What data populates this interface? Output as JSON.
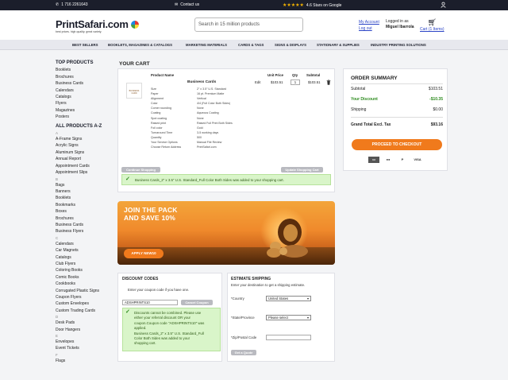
{
  "topbar": {
    "phone": "1 716 2261643",
    "contact": "Contact us",
    "rating_stars": "★★★★★",
    "rating_text": "4.6 Stars on Google"
  },
  "header": {
    "logo_text": "PrintSafari.com",
    "logo_tagline": "best prices. high quality. great variety.",
    "search_placeholder": "Search in 15 million products",
    "my_account": "My Account",
    "logout": "Log out",
    "logged_in_as": "Logged in as",
    "user_name": "Miguel Ibarrola",
    "cart_label": "Cart (1 Items)"
  },
  "nav": {
    "items": [
      "BEST SELLERS",
      "BOOKLETS, MAGAZINES & CATALOGS",
      "MARKETING MATERIALS",
      "CARDS & TAGS",
      "SIGNS & DISPLAYS",
      "STATIONARY & SUPPLIES",
      "INDUSTRY PRINTING SOLUTIONS"
    ]
  },
  "sidebar": {
    "top_products_title": "TOP PRODUCTS",
    "top_products": [
      "Booklets",
      "Brochures",
      "Business Cards",
      "Calendars",
      "Catalogs",
      "Flyers",
      "Magazines",
      "Posters"
    ],
    "all_title": "ALL PRODUCTS A-Z",
    "groups": [
      {
        "letter": "A",
        "items": [
          "A-Frame Signs",
          "Acrylic Signs",
          "Aluminum Signs",
          "Annual Report",
          "Appointment Cards",
          "Appointment Slips"
        ]
      },
      {
        "letter": "B",
        "items": [
          "Bags",
          "Banners",
          "Booklets",
          "Bookmarks",
          "Boxes",
          "Brochures",
          "Business Cards",
          "Business Flyers"
        ]
      },
      {
        "letter": "C",
        "items": [
          "Calendars",
          "Car Magnets",
          "Catalogs",
          "Club Flyers",
          "Coloring Books",
          "Comic Books",
          "Cookbooks",
          "Corrugated Plastic Signs",
          "Coupon Flyers",
          "Custom Envelopes",
          "Custom Trading Cards"
        ]
      },
      {
        "letter": "D",
        "items": [
          "Desk Pads",
          "Door Hangers"
        ]
      },
      {
        "letter": "E",
        "items": [
          "Envelopes",
          "Event Tickets"
        ]
      },
      {
        "letter": "F",
        "items": [
          "Flags"
        ]
      }
    ]
  },
  "cart": {
    "title": "YOUR CART",
    "col_product": "Product Name",
    "col_price": "Unit Price",
    "col_qty": "Qty",
    "col_subtotal": "Subtotal",
    "thumb_text": "BUSINESS CARD",
    "item": {
      "name": "Business Cards",
      "edit": "Edit",
      "price": "$103.51",
      "qty": "1",
      "subtotal": "$103.51",
      "specs": [
        [
          "Size",
          "2\" x 3.5\" U.S. Standard"
        ],
        [
          "Paper",
          "16 pt. Premium Matte"
        ],
        [
          "Alignment",
          "Vertical"
        ],
        [
          "Color",
          "4/4 (Full Color Both Sides)"
        ],
        [
          "Corner rounding",
          "None"
        ],
        [
          "Coating",
          "Aqueous Coating"
        ],
        [
          "Spot coating",
          "None"
        ],
        [
          "Raised print",
          "Raised Full Print Both Sides"
        ],
        [
          "Foil color",
          "Gold"
        ],
        [
          "Turnaround Time",
          "3-5 working days"
        ],
        [
          "Quantity",
          "500"
        ],
        [
          "Your Service Options",
          "Manual File Review"
        ],
        [
          "Choose Return Address",
          "PrintSafari.com"
        ]
      ]
    },
    "continue_btn": "Continue Shopping",
    "update_btn": "Update Shopping Cart",
    "added_notice": "Business Cards_2\" x 3.5\" U.S. Standard_Full Color Both Sides was added to your shopping cart."
  },
  "banner": {
    "title_line1": "JOIN THE PACK",
    "title_line2": "AND SAVE 10%",
    "button": "APPLY NEW10"
  },
  "discount": {
    "title": "DISCOUNT CODES",
    "hint": "Enter your coupon code if you have one.",
    "code_value": "ADSHPRINTS10",
    "cancel_btn": "Cancel Coupon",
    "notice_lines": [
      "Discounts cannot be combined. Please use",
      "either your referral discount OR your",
      "coupon.Coupon code \"ADSHPRINTS10\" was",
      "applied.",
      "Business Cards_2\" x 3.5\" U.S. Standard_Full",
      "Color Both Sides was added to your",
      "shopping cart."
    ]
  },
  "shipping": {
    "title": "ESTIMATE SHIPPING",
    "hint": "Enter your destination to get a shipping estimate.",
    "country_label": "*Country",
    "country_value": "United States",
    "state_label": "*State/Province",
    "state_value": "Please select",
    "zip_label": "*Zip/Postal Code",
    "quote_btn": "Get a Quote"
  },
  "summary": {
    "title": "ORDER SUMMARY",
    "subtotal_label": "Subtotal",
    "subtotal_value": "$103.51",
    "discount_label": "Your Discount",
    "discount_value": "-$10.35",
    "shipping_label": "Shipping",
    "shipping_value": "$0.00",
    "grand_label": "Grand Total Excl. Tax",
    "grand_value": "$93.16",
    "checkout_btn": "PROCEED TO CHECKOUT",
    "pay_methods": [
      "▭",
      "●●",
      "P",
      "VISA"
    ]
  },
  "colors": {
    "accent": "#f07a1c",
    "discount_green": "#2e8b1f",
    "link_blue": "#2b44c6",
    "topbar": "#1b1e2b"
  }
}
